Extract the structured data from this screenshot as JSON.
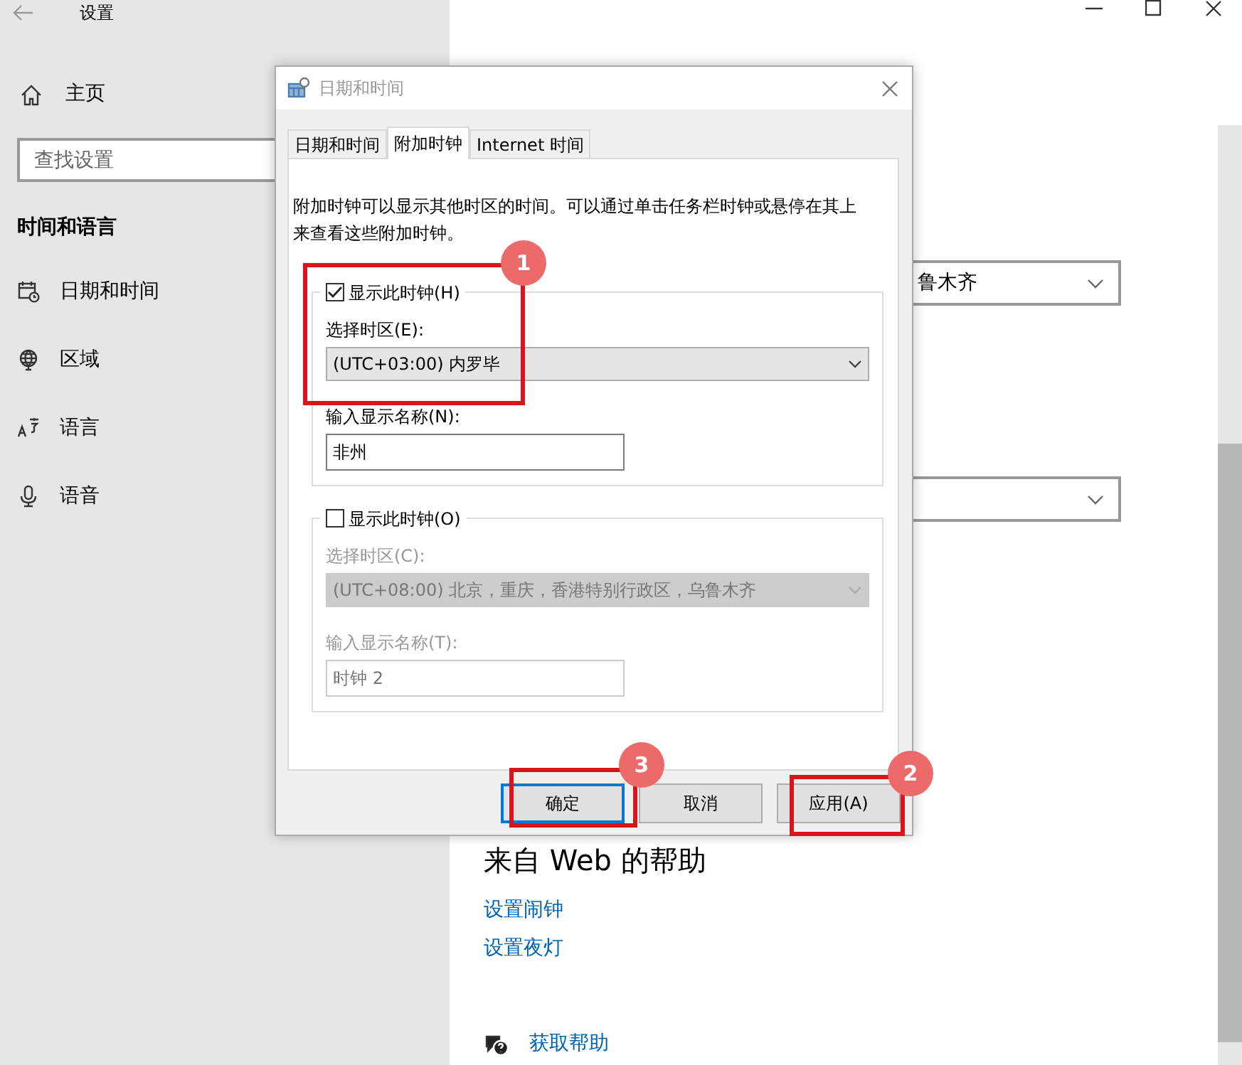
{
  "settings": {
    "title": "设置",
    "home": "主页",
    "search": {
      "placeholder": "查找设置"
    },
    "section": "时间和语言",
    "nav": [
      {
        "label": "日期和时间"
      },
      {
        "label": "区域"
      },
      {
        "label": "语言"
      },
      {
        "label": "语音"
      }
    ],
    "dropdowns": [
      {
        "kind": "text",
        "value": "鲁木齐"
      },
      {
        "kind": "empty"
      }
    ],
    "help": {
      "title": "来自 Web 的帮助",
      "links": [
        "设置闹钟",
        "设置夜灯"
      ],
      "get_help": "获取帮助"
    }
  },
  "dialog": {
    "title": "日期和时间",
    "tabs": [
      {
        "label": "日期和时间",
        "selected": false
      },
      {
        "label": "附加时钟",
        "selected": true
      },
      {
        "label": "Internet 时间",
        "selected": false
      }
    ],
    "description": "附加时钟可以显示其他时区的时间。可以通过单击任务栏时钟或悬停在其上来查看这些附加时钟。",
    "clocks": [
      {
        "checkbox_label": "显示此时钟(H)",
        "checked": true,
        "disabled": false,
        "zone_label": "选择时区(E):",
        "zone": "(UTC+03:00) 内罗毕",
        "name_label": "输入显示名称(N):",
        "name": "非州"
      },
      {
        "checkbox_label": "显示此时钟(O)",
        "checked": false,
        "disabled": true,
        "zone_label": "选择时区(C):",
        "zone": "(UTC+08:00) 北京，重庆，香港特别行政区，乌鲁木齐",
        "name_label": "输入显示名称(T):",
        "name": "时钟 2"
      }
    ],
    "buttons": [
      {
        "label": "确定",
        "default": true
      },
      {
        "label": "取消",
        "default": false
      },
      {
        "label": "应用(A)",
        "default": false
      }
    ]
  },
  "annotations": [
    {
      "number": "1"
    },
    {
      "number": "2"
    },
    {
      "number": "3"
    }
  ]
}
